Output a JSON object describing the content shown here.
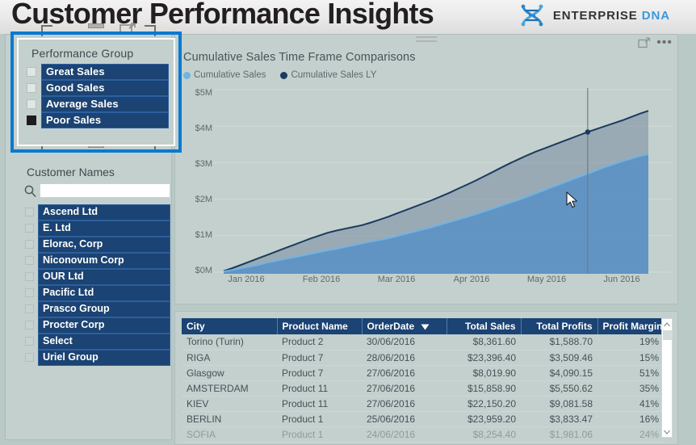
{
  "header": {
    "title": "Customer Performance Insights",
    "brand_primary": "ENTERPRISE",
    "brand_secondary": "DNA",
    "brand_icon": "dna-helix-icon"
  },
  "slicers": {
    "performance_group": {
      "title": "Performance Group",
      "items": [
        {
          "label": "Great Sales",
          "selected": false
        },
        {
          "label": "Good Sales",
          "selected": false
        },
        {
          "label": "Average Sales",
          "selected": false
        },
        {
          "label": "Poor Sales",
          "selected": true
        }
      ]
    },
    "customer_names": {
      "title": "Customer Names",
      "search_value": "",
      "search_placeholder": "",
      "search_icon": "search-icon",
      "items": [
        {
          "label": "Ascend Ltd",
          "selected": false
        },
        {
          "label": "E. Ltd",
          "selected": false
        },
        {
          "label": "Elorac, Corp",
          "selected": false
        },
        {
          "label": "Niconovum Corp",
          "selected": false
        },
        {
          "label": "OUR Ltd",
          "selected": false
        },
        {
          "label": "Pacific Ltd",
          "selected": false
        },
        {
          "label": "Prasco Group",
          "selected": false
        },
        {
          "label": "Procter Corp",
          "selected": false
        },
        {
          "label": "Select",
          "selected": false
        },
        {
          "label": "Uriel Group",
          "selected": false
        }
      ]
    }
  },
  "chart_panel": {
    "focus_icon": "focus-mode-icon",
    "more_options": "•••"
  },
  "chart_data": {
    "type": "area",
    "title": "Cumulative Sales Time Frame Comparisons",
    "xlabel": "",
    "ylabel": "",
    "ylim": [
      0,
      5000000
    ],
    "ytick_labels": [
      "$0M",
      "$1M",
      "$2M",
      "$3M",
      "$4M",
      "$5M"
    ],
    "ytick_values": [
      0,
      1000000,
      2000000,
      3000000,
      4000000,
      5000000
    ],
    "xtick_labels": [
      "Jan 2016",
      "Feb 2016",
      "Mar 2016",
      "Apr 2016",
      "May 2016",
      "Jun 2016"
    ],
    "grid": true,
    "legend_position": "top-left",
    "colors": {
      "cumulative_sales": "#6FB3E3",
      "cumulative_sales_ly": "#1B3B5E"
    },
    "tooltip_line_x_label": "Jun 2016",
    "series": [
      {
        "name": "Cumulative Sales",
        "color": "#6FB3E3",
        "values": [
          20000,
          60000,
          110000,
          150000,
          200000,
          260000,
          310000,
          360000,
          400000,
          450000,
          500000,
          550000,
          600000,
          640000,
          690000,
          740000,
          790000,
          840000,
          880000,
          930000,
          990000,
          1050000,
          1110000,
          1170000,
          1230000,
          1300000,
          1370000,
          1440000,
          1510000,
          1580000,
          1660000,
          1740000,
          1820000,
          1900000,
          1980000,
          2070000,
          2160000,
          2250000,
          2340000,
          2430000,
          2520000,
          2610000,
          2700000,
          2790000,
          2880000,
          2960000,
          3040000,
          3110000,
          3180000,
          3240000
        ]
      },
      {
        "name": "Cumulative Sales LY",
        "color": "#1B3B5E",
        "values": [
          30000,
          110000,
          200000,
          290000,
          380000,
          470000,
          560000,
          650000,
          740000,
          830000,
          920000,
          1000000,
          1080000,
          1140000,
          1190000,
          1240000,
          1290000,
          1360000,
          1440000,
          1520000,
          1610000,
          1700000,
          1790000,
          1880000,
          1970000,
          2070000,
          2170000,
          2280000,
          2390000,
          2500000,
          2620000,
          2740000,
          2860000,
          2980000,
          3090000,
          3200000,
          3300000,
          3390000,
          3480000,
          3570000,
          3660000,
          3750000,
          3840000,
          3920000,
          4000000,
          4080000,
          4160000,
          4250000,
          4340000,
          4420000
        ]
      }
    ]
  },
  "table": {
    "columns": [
      {
        "label": "City",
        "align": "left",
        "sorted": false
      },
      {
        "label": "Product Name",
        "align": "left",
        "sorted": false
      },
      {
        "label": "OrderDate",
        "align": "left",
        "sorted": true
      },
      {
        "label": "Total Sales",
        "align": "right",
        "sorted": false
      },
      {
        "label": "Total Profits",
        "align": "right",
        "sorted": false
      },
      {
        "label": "Profit Margin",
        "align": "right",
        "sorted": false
      }
    ],
    "rows": [
      [
        "Torino (Turin)",
        "Product 2",
        "30/06/2016",
        "$8,361.60",
        "$1,588.70",
        "19%"
      ],
      [
        "RIGA",
        "Product 7",
        "28/06/2016",
        "$23,396.40",
        "$3,509.46",
        "15%"
      ],
      [
        "Glasgow",
        "Product 7",
        "27/06/2016",
        "$8,019.90",
        "$4,090.15",
        "51%"
      ],
      [
        "AMSTERDAM",
        "Product 11",
        "27/06/2016",
        "$15,858.90",
        "$5,550.62",
        "35%"
      ],
      [
        "KIEV",
        "Product 11",
        "27/06/2016",
        "$22,150.20",
        "$9,081.58",
        "41%"
      ],
      [
        "BERLIN",
        "Product 1",
        "25/06/2016",
        "$23,959.20",
        "$3,833.47",
        "16%"
      ],
      [
        "SOFIA",
        "Product 1",
        "24/06/2016",
        "$8,254.40",
        "$1,981.06",
        "24%"
      ]
    ]
  }
}
